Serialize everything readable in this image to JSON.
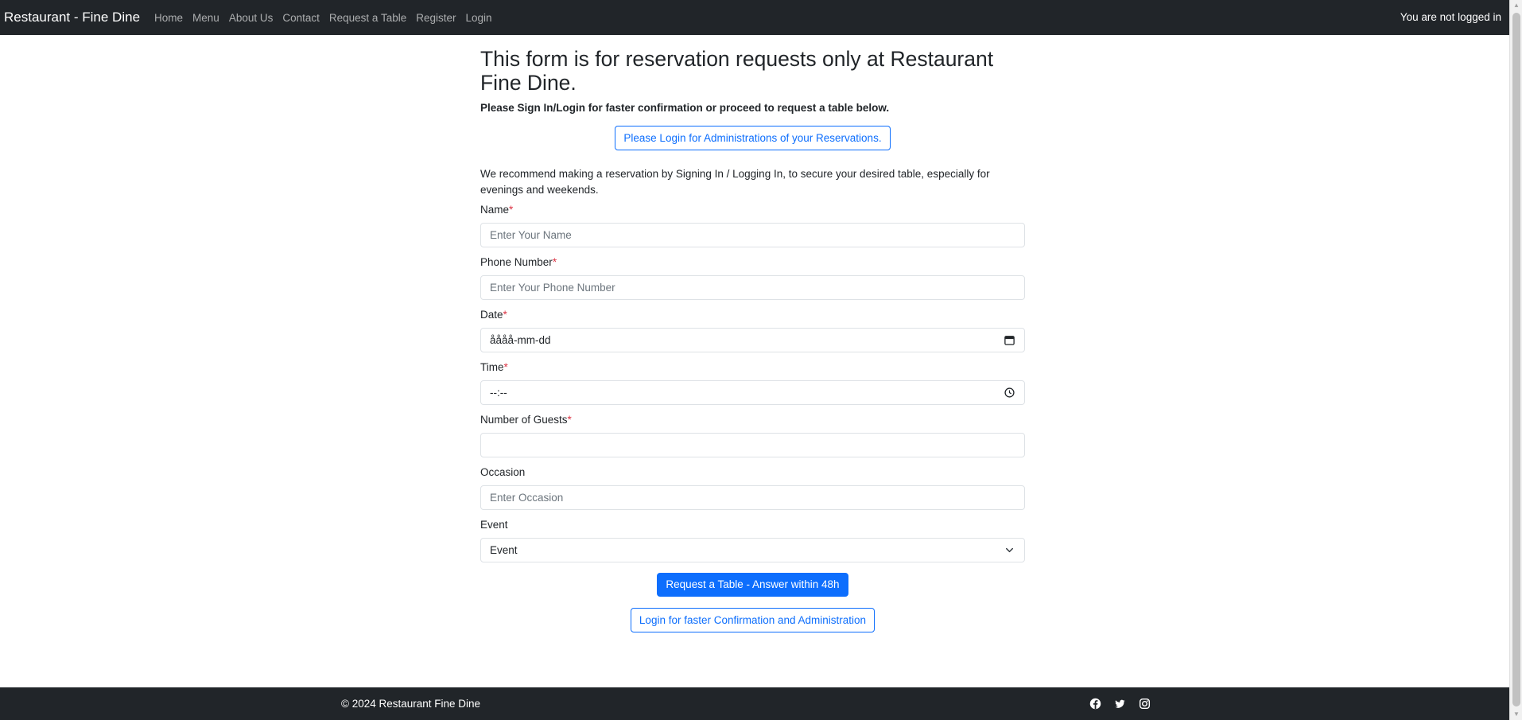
{
  "navbar": {
    "brand": "Restaurant - Fine Dine",
    "links": [
      "Home",
      "Menu",
      "About Us",
      "Contact",
      "Request a Table",
      "Register",
      "Login"
    ],
    "status": "You are not logged in"
  },
  "main": {
    "title": "This form is for reservation requests only at Restaurant Fine Dine.",
    "subtitle": "Please Sign In/Login for faster confirmation or proceed to request a table below.",
    "login_admin_button": "Please Login for Administrations of your Reservations.",
    "recommend": "We recommend making a reservation by Signing In / Logging In, to secure your desired table, especially for evenings and weekends."
  },
  "form": {
    "name": {
      "label": "Name",
      "placeholder": "Enter Your Name",
      "required_mark": "*"
    },
    "phone": {
      "label": "Phone Number",
      "placeholder": "Enter Your Phone Number",
      "required_mark": "*"
    },
    "date": {
      "label": "Date",
      "value": "åååå-mm-dd",
      "required_mark": "*"
    },
    "time": {
      "label": "Time",
      "value": "--:--",
      "required_mark": "*"
    },
    "guests": {
      "label": "Number of Guests",
      "value": "",
      "required_mark": "*"
    },
    "occasion": {
      "label": "Occasion",
      "placeholder": "Enter Occasion"
    },
    "event": {
      "label": "Event",
      "selected": "Event"
    },
    "submit_button": "Request a Table - Answer within 48h",
    "login_button": "Login for faster Confirmation and Administration"
  },
  "footer": {
    "copyright": "© 2024 Restaurant Fine Dine",
    "social_icons": [
      "facebook-icon",
      "twitter-icon",
      "instagram-icon"
    ]
  },
  "colors": {
    "navbar_bg": "#212529",
    "primary": "#0d6efd",
    "required": "#dc3545"
  }
}
